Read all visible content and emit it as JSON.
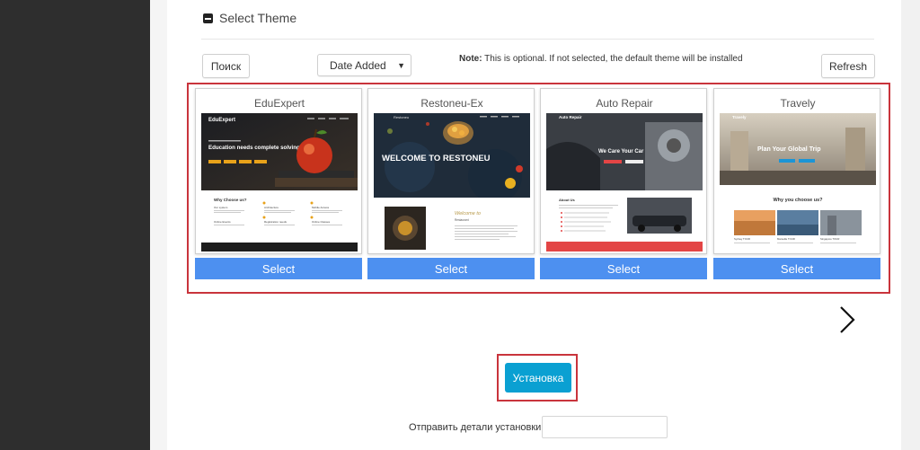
{
  "section": {
    "title": "Select Theme"
  },
  "toolbar": {
    "search_label": "Поиск",
    "sort_selected": "Date Added",
    "note_label": "Note:",
    "note_text": " This is optional. If not selected, the default theme will be installed",
    "refresh_label": "Refresh"
  },
  "themes": [
    {
      "name": "EduExpert",
      "select_label": "Select",
      "preview": {
        "brand": "EduExpert",
        "headline": "Education needs complete solving",
        "section": "Why Choose us?",
        "features": [
          "Our system",
          "Architecture",
          "Mobile Access",
          "Online Events",
          "Registration needs",
          "Online Classes"
        ]
      }
    },
    {
      "name": "Restoneu-Ex",
      "select_label": "Select",
      "preview": {
        "brand": "Restoneu",
        "headline": "WELCOME TO RESTONEU",
        "script": "Welcome to",
        "subheading": "Restaurant"
      }
    },
    {
      "name": "Auto Repair",
      "select_label": "Select",
      "preview": {
        "brand": "Auto Repair",
        "headline": "We Care Your Car",
        "section": "About Us"
      }
    },
    {
      "name": "Travely",
      "select_label": "Select",
      "preview": {
        "brand": "Travely",
        "headline": "Plan Your Global Trip",
        "section": "Why you choose us?",
        "captions": [
          "Sydney TOUR",
          "Marseille TOUR",
          "Singapore TOUR"
        ]
      }
    }
  ],
  "install": {
    "button_label": "Установка",
    "send_label": "Отправить детали установки :"
  },
  "colors": {
    "select_button": "#4d90f0",
    "install_button": "#0aa0d2",
    "highlight_border": "#c9343c",
    "sidebar": "#2e2e2e"
  }
}
